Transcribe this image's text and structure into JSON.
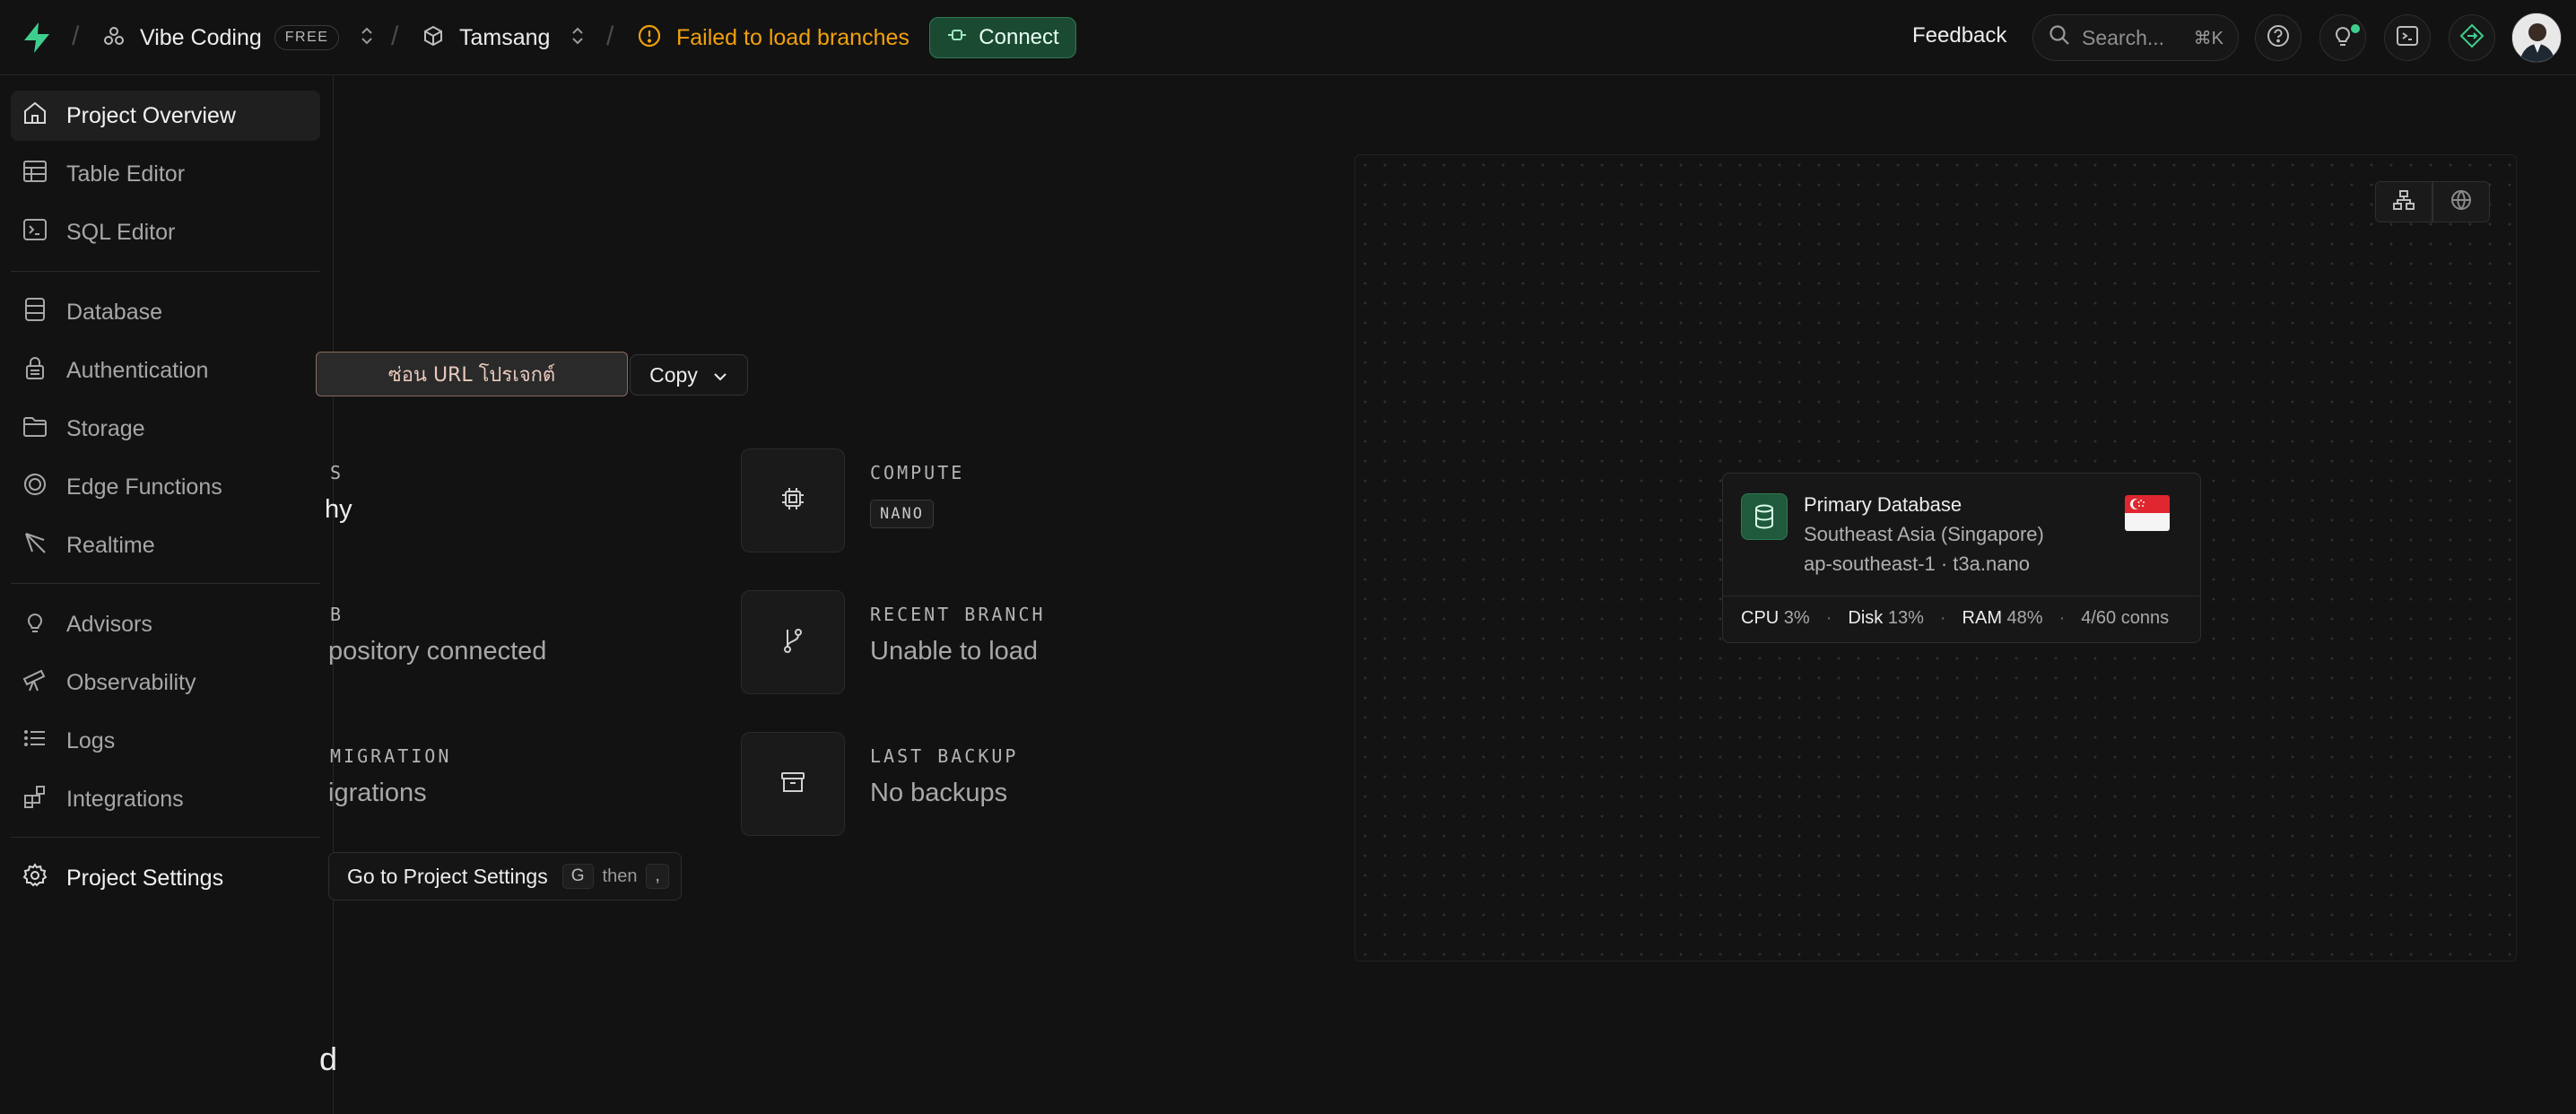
{
  "topbar": {
    "org_name": "Vibe Coding",
    "plan_badge": "FREE",
    "project_name": "Tamsang",
    "branch_error": "Failed to load branches",
    "connect_label": "Connect",
    "feedback_label": "Feedback",
    "search_placeholder": "Search...",
    "search_shortcut": "⌘K",
    "separator": "/"
  },
  "sidebar": {
    "items": [
      {
        "label": "Project Overview",
        "icon": "home-icon"
      },
      {
        "label": "Table Editor",
        "icon": "table-icon"
      },
      {
        "label": "SQL Editor",
        "icon": "terminal-icon"
      },
      {
        "label": "Database",
        "icon": "database-icon"
      },
      {
        "label": "Authentication",
        "icon": "lock-icon"
      },
      {
        "label": "Storage",
        "icon": "folder-icon"
      },
      {
        "label": "Edge Functions",
        "icon": "edge-functions-icon"
      },
      {
        "label": "Realtime",
        "icon": "realtime-icon"
      },
      {
        "label": "Advisors",
        "icon": "lightbulb-icon"
      },
      {
        "label": "Observability",
        "icon": "telescope-icon"
      },
      {
        "label": "Logs",
        "icon": "list-icon"
      },
      {
        "label": "Integrations",
        "icon": "blocks-icon"
      },
      {
        "label": "Project Settings",
        "icon": "gear-icon"
      }
    ]
  },
  "main": {
    "url_box_label": "ซ่อน URL โปรเจกต์",
    "copy_label": "Copy",
    "stats": {
      "status_label_partial": "S",
      "status_value_partial": "hy",
      "github_label_partial": "B",
      "github_value_partial": "pository connected",
      "migration_label_partial": "MIGRATION",
      "migration_value_partial": "igrations",
      "compute_label": "COMPUTE",
      "compute_badge": "NANO",
      "branch_label": "RECENT BRANCH",
      "branch_value": "Unable to load",
      "backup_label": "LAST BACKUP",
      "backup_value": "No backups"
    },
    "tooltip": {
      "text": "Go to Project Settings",
      "key1": "G",
      "then": "then",
      "key2": ","
    },
    "bottom_partial": "d"
  },
  "diagram": {
    "card": {
      "title": "Primary Database",
      "region": "Southeast Asia (Singapore)",
      "instance": "ap-southeast-1 · t3a.nano",
      "cpu_label": "CPU",
      "cpu_value": "3%",
      "disk_label": "Disk",
      "disk_value": "13%",
      "ram_label": "RAM",
      "ram_value": "48%",
      "conns": "4/60 conns",
      "dot": "·"
    }
  },
  "colors": {
    "accent_green": "#3ecf8e",
    "warning": "#f1a10d",
    "connect_bg": "#1b4a33",
    "background": "#121212"
  }
}
